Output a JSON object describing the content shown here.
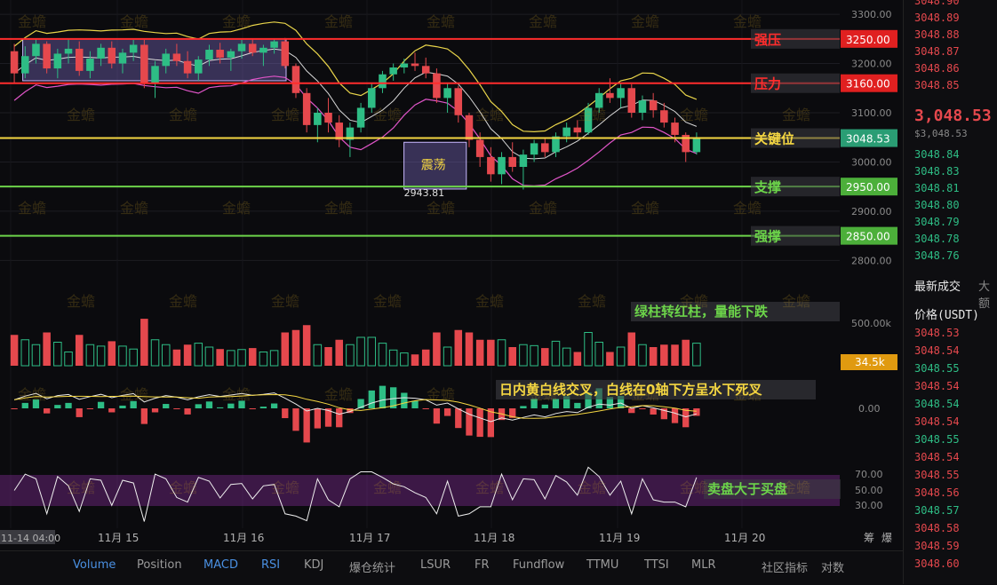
{
  "colors": {
    "up": "#2ebd85",
    "down": "#e5484d",
    "background": "#0b0b0e",
    "yellow": "#f5d742",
    "red_line": "#ff2d2d",
    "green_line": "#6cd44a",
    "accent": "#4a90e2"
  },
  "watermark": "金蟾",
  "toolbar": {
    "items": [
      {
        "label": "Volume",
        "active": true
      },
      {
        "label": "Position",
        "active": false
      },
      {
        "label": "MACD",
        "active": true
      },
      {
        "label": "RSI",
        "active": true
      },
      {
        "label": "KDJ",
        "active": false
      },
      {
        "label": "爆仓统计",
        "active": false
      },
      {
        "label": "LSUR",
        "active": false
      },
      {
        "label": "FR",
        "active": false
      },
      {
        "label": "Fundflow",
        "active": false
      },
      {
        "label": "TTMU",
        "active": false
      },
      {
        "label": "TTSI",
        "active": false
      },
      {
        "label": "MLR",
        "active": false
      },
      {
        "label": "社区指标",
        "active": false
      },
      {
        "label": "对数",
        "active": false
      }
    ]
  },
  "right_panel": {
    "asks": [
      "3048.90",
      "3048.89",
      "3048.88",
      "3048.87",
      "3048.86",
      "3048.85"
    ],
    "last_price": "3,048.53",
    "last_price_sub": "$3,048.53",
    "bids": [
      "3048.84",
      "3048.83",
      "3048.81",
      "3048.80",
      "3048.79",
      "3048.78",
      "3048.76"
    ],
    "trades_title": "最新成交",
    "trades_tab2": "大额",
    "price_header": "价格(USDT)",
    "trades": [
      {
        "p": "3048.53",
        "side": "down"
      },
      {
        "p": "3048.54",
        "side": "down"
      },
      {
        "p": "3048.55",
        "side": "up"
      },
      {
        "p": "3048.54",
        "side": "down"
      },
      {
        "p": "3048.54",
        "side": "up"
      },
      {
        "p": "3048.54",
        "side": "down"
      },
      {
        "p": "3048.55",
        "side": "up"
      },
      {
        "p": "3048.54",
        "side": "down"
      },
      {
        "p": "3048.55",
        "side": "down"
      },
      {
        "p": "3048.56",
        "side": "down"
      },
      {
        "p": "3048.57",
        "side": "up"
      },
      {
        "p": "3048.58",
        "side": "down"
      },
      {
        "p": "3048.59",
        "side": "down"
      },
      {
        "p": "3048.60",
        "side": "down"
      }
    ]
  },
  "chart_data": {
    "type": "candlestick",
    "price_axis": {
      "min": 2770,
      "max": 3320,
      "ticks": [
        2800,
        2900,
        3000,
        3100,
        3200,
        3300
      ],
      "tick_labels": [
        "2800.00",
        "2900.00",
        "3000.00",
        "3100.00",
        "3200.00",
        "3300.00"
      ]
    },
    "x_labels": [
      "11-14 04:00",
      "11月 15",
      "11月 16",
      "11月 17",
      "11月 18",
      "11月 19",
      "11月 20"
    ],
    "current_price": {
      "value": 3048.53,
      "label": "3048.53"
    },
    "levels": [
      {
        "name": "强压",
        "value": 3250.0,
        "label": "3250.00",
        "color": "#ff2d2d"
      },
      {
        "name": "压力",
        "value": 3160.0,
        "label": "3160.00",
        "color": "#ff2d2d"
      },
      {
        "name": "关键位",
        "value": 3048.53,
        "label": "3048.53",
        "color": "#f5d742"
      },
      {
        "name": "支撑",
        "value": 2950.0,
        "label": "2950.00",
        "color": "#6cd44a"
      },
      {
        "name": "强撑",
        "value": 2850.0,
        "label": "2850.00",
        "color": "#6cd44a"
      }
    ],
    "boxes": [
      {
        "label": "",
        "from": 0.02,
        "to": 0.4,
        "high": 3250,
        "low": 3165
      },
      {
        "label": "震荡",
        "from": 0.57,
        "to": 0.66,
        "high": 3040,
        "low": 2945,
        "low_label": "2943.81"
      }
    ],
    "candles": [
      [
        3225,
        3240,
        3160,
        3180
      ],
      [
        3180,
        3235,
        3170,
        3215
      ],
      [
        3215,
        3250,
        3200,
        3240
      ],
      [
        3240,
        3245,
        3180,
        3190
      ],
      [
        3190,
        3230,
        3170,
        3220
      ],
      [
        3220,
        3250,
        3200,
        3230
      ],
      [
        3230,
        3245,
        3175,
        3185
      ],
      [
        3185,
        3225,
        3170,
        3210
      ],
      [
        3210,
        3240,
        3195,
        3232
      ],
      [
        3232,
        3245,
        3190,
        3200
      ],
      [
        3200,
        3230,
        3180,
        3222
      ],
      [
        3222,
        3248,
        3205,
        3238
      ],
      [
        3238,
        3248,
        3150,
        3160
      ],
      [
        3160,
        3205,
        3130,
        3195
      ],
      [
        3195,
        3230,
        3180,
        3220
      ],
      [
        3220,
        3240,
        3195,
        3205
      ],
      [
        3205,
        3225,
        3170,
        3180
      ],
      [
        3180,
        3215,
        3165,
        3208
      ],
      [
        3208,
        3238,
        3195,
        3228
      ],
      [
        3228,
        3242,
        3200,
        3212
      ],
      [
        3212,
        3230,
        3185,
        3225
      ],
      [
        3225,
        3248,
        3210,
        3240
      ],
      [
        3240,
        3250,
        3215,
        3222
      ],
      [
        3222,
        3238,
        3195,
        3232
      ],
      [
        3232,
        3250,
        3220,
        3245
      ],
      [
        3245,
        3252,
        3190,
        3195
      ],
      [
        3195,
        3200,
        3130,
        3140
      ],
      [
        3140,
        3150,
        3060,
        3075
      ],
      [
        3075,
        3110,
        3040,
        3100
      ],
      [
        3100,
        3130,
        3060,
        3080
      ],
      [
        3080,
        3095,
        3030,
        3045
      ],
      [
        3045,
        3080,
        3010,
        3070
      ],
      [
        3070,
        3120,
        3060,
        3110
      ],
      [
        3110,
        3160,
        3100,
        3150
      ],
      [
        3150,
        3185,
        3140,
        3178
      ],
      [
        3178,
        3200,
        3165,
        3192
      ],
      [
        3192,
        3210,
        3180,
        3200
      ],
      [
        3200,
        3222,
        3185,
        3195
      ],
      [
        3195,
        3212,
        3170,
        3180
      ],
      [
        3180,
        3190,
        3120,
        3130
      ],
      [
        3130,
        3160,
        3100,
        3150
      ],
      [
        3150,
        3155,
        3080,
        3095
      ],
      [
        3095,
        3100,
        3030,
        3045
      ],
      [
        3045,
        3060,
        2990,
        3010
      ],
      [
        3010,
        3030,
        2960,
        2975
      ],
      [
        2975,
        3020,
        2955,
        3010
      ],
      [
        3010,
        3040,
        2980,
        2990
      ],
      [
        2990,
        3025,
        2944,
        3015
      ],
      [
        3015,
        3045,
        3000,
        3038
      ],
      [
        3038,
        3050,
        3010,
        3020
      ],
      [
        3020,
        3060,
        3010,
        3052
      ],
      [
        3052,
        3080,
        3040,
        3070
      ],
      [
        3070,
        3085,
        3050,
        3060
      ],
      [
        3060,
        3120,
        3055,
        3110
      ],
      [
        3110,
        3150,
        3100,
        3140
      ],
      [
        3140,
        3170,
        3120,
        3130
      ],
      [
        3130,
        3160,
        3110,
        3150
      ],
      [
        3150,
        3158,
        3090,
        3100
      ],
      [
        3100,
        3135,
        3085,
        3125
      ],
      [
        3125,
        3140,
        3090,
        3105
      ],
      [
        3105,
        3120,
        3070,
        3080
      ],
      [
        3080,
        3090,
        3040,
        3055
      ],
      [
        3055,
        3060,
        3000,
        3020
      ],
      [
        3020,
        3060,
        3015,
        3048
      ]
    ],
    "volume": {
      "axis_label": "500.00k",
      "current_label": "34.5k"
    },
    "macd": {
      "axis_label": "0.00"
    },
    "rsi": {
      "axis_labels": [
        "70.00",
        "50.00",
        "30.00"
      ]
    },
    "annotations": [
      {
        "text": "绿柱转红柱，量能下跌",
        "color": "#6cd44a"
      },
      {
        "text": "日内黄白线交叉，白线在0轴下方呈水下死叉",
        "color": "#f5d742"
      },
      {
        "text": "卖盘大于买盘",
        "color": "#6cd44a"
      }
    ],
    "corner_labels": [
      "筹",
      "爆"
    ]
  }
}
